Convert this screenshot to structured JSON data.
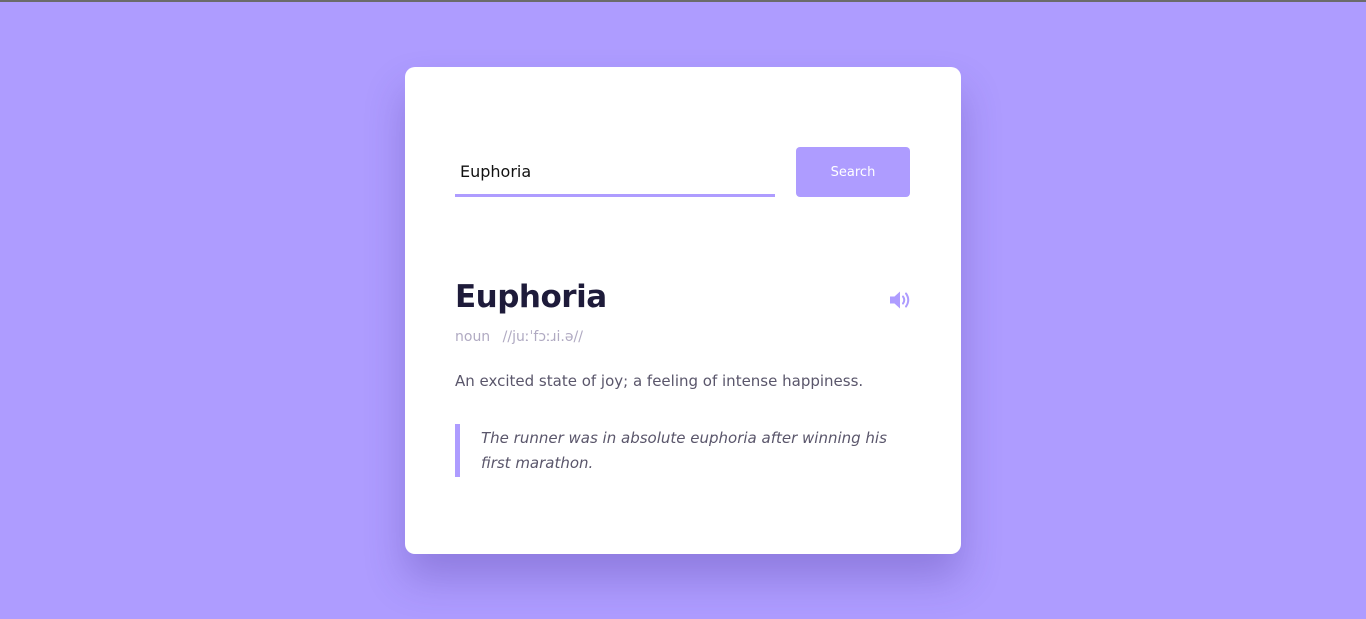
{
  "search": {
    "value": "Euphoria",
    "button_label": "Search"
  },
  "result": {
    "word": "Euphoria",
    "part_of_speech": "noun",
    "phonetic": "//juːˈfɔːɹi.ə//",
    "definition": "An excited state of joy; a feeling of intense happiness.",
    "example": "The runner was in absolute euphoria after winning his first marathon.",
    "audio_icon": "speaker-volume-icon"
  },
  "colors": {
    "accent": "#ae9cff",
    "background": "#ae9cff",
    "card": "#ffffff",
    "heading": "#1e1b3a",
    "body_text": "#5a566b",
    "muted_text": "#b0aac2"
  }
}
